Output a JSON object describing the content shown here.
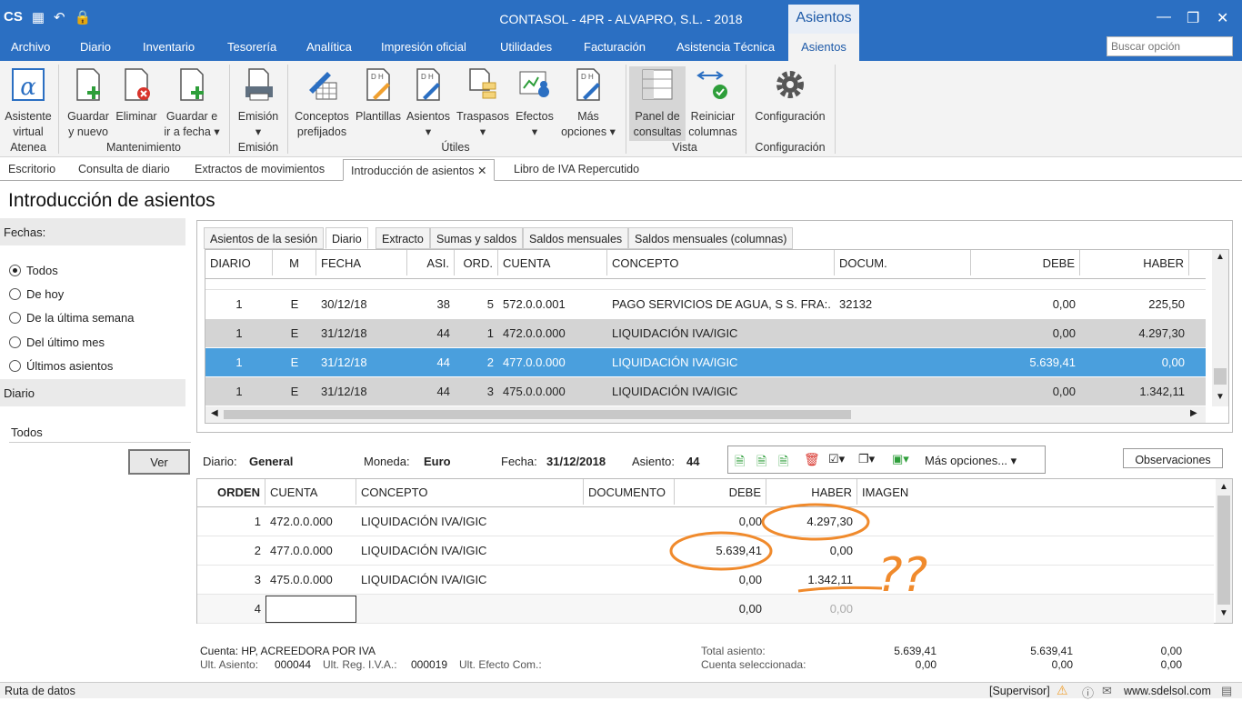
{
  "app": {
    "title": "CONTASOL - 4PR - ALVAPRO, S.L. - 2018",
    "context_tab": "Asientos",
    "logo_text": "CS"
  },
  "menu": {
    "items": [
      "Archivo",
      "Diario",
      "Inventario",
      "Tesorería",
      "Analítica",
      "Impresión oficial",
      "Utilidades",
      "Facturación",
      "Asistencia Técnica"
    ],
    "active": "Asientos",
    "search_placeholder": "Buscar opción"
  },
  "ribbon": {
    "buttons": [
      {
        "label1": "Asistente",
        "label2": "virtual"
      },
      {
        "label1": "Guardar",
        "label2": "y nuevo"
      },
      {
        "label1": "Eliminar",
        "label2": ""
      },
      {
        "label1": "Guardar e",
        "label2": "ir a fecha"
      },
      {
        "label1": "Emisión",
        "label2": ""
      },
      {
        "label1": "Conceptos",
        "label2": "prefijados"
      },
      {
        "label1": "Plantillas",
        "label2": ""
      },
      {
        "label1": "Asientos",
        "label2": ""
      },
      {
        "label1": "Traspasos",
        "label2": ""
      },
      {
        "label1": "Efectos",
        "label2": ""
      },
      {
        "label1": "Más",
        "label2": "opciones"
      },
      {
        "label1": "Panel de",
        "label2": "consultas"
      },
      {
        "label1": "Reiniciar",
        "label2": "columnas"
      },
      {
        "label1": "Configuración",
        "label2": ""
      }
    ],
    "groups": [
      "Atenea",
      "Mantenimiento",
      "Emisión",
      "Útiles",
      "Vista",
      "Configuración"
    ]
  },
  "doc_tabs": [
    "Escritorio",
    "Consulta de diario",
    "Extractos de movimientos",
    "Introducción de asientos",
    "Libro de IVA Repercutido"
  ],
  "page": {
    "title": "Introducción de asientos",
    "fechas_label": "Fechas:",
    "radios": [
      "Todos",
      "De hoy",
      "De la última semana",
      "Del último mes",
      "Últimos asientos"
    ],
    "diario_label": "Diario",
    "diario_value": "Todos",
    "ver_button": "Ver"
  },
  "upper": {
    "tabs": [
      "Asientos de la sesión",
      "Diario",
      "Extracto",
      "Sumas y saldos",
      "Saldos mensuales",
      "Saldos mensuales (columnas)"
    ],
    "columns": [
      "DIARIO",
      "M",
      "FECHA",
      "ASI.",
      "ORD.",
      "CUENTA",
      "CONCEPTO",
      "DOCUM.",
      "DEBE",
      "HABER"
    ],
    "rows": [
      [
        "1",
        "E",
        "30/12/18",
        "38",
        "5",
        "572.0.0.001",
        "PAGO SERVICIOS DE AGUA, S S. FRA:...",
        "32132",
        "0,00",
        "225,50"
      ],
      [
        "1",
        "E",
        "31/12/18",
        "44",
        "1",
        "472.0.0.000",
        "LIQUIDACIÓN IVA/IGIC",
        "",
        "0,00",
        "4.297,30"
      ],
      [
        "1",
        "E",
        "31/12/18",
        "44",
        "2",
        "477.0.0.000",
        "LIQUIDACIÓN IVA/IGIC",
        "",
        "5.639,41",
        "0,00"
      ],
      [
        "1",
        "E",
        "31/12/18",
        "44",
        "3",
        "475.0.0.000",
        "LIQUIDACIÓN IVA/IGIC",
        "",
        "0,00",
        "1.342,11"
      ]
    ]
  },
  "header_info": {
    "diario_lbl": "Diario:",
    "diario_val": "General",
    "moneda_lbl": "Moneda:",
    "moneda_val": "Euro",
    "fecha_lbl": "Fecha:",
    "fecha_val": "31/12/2018",
    "asiento_lbl": "Asiento:",
    "asiento_val": "44",
    "mas_opciones": "Más opciones...",
    "observaciones": "Observaciones"
  },
  "lower": {
    "columns": [
      "ORDEN",
      "CUENTA",
      "CONCEPTO",
      "DOCUMENTO",
      "DEBE",
      "HABER",
      "IMAGEN"
    ],
    "rows": [
      [
        "1",
        "472.0.0.000",
        "LIQUIDACIÓN IVA/IGIC",
        "",
        "0,00",
        "4.297,30"
      ],
      [
        "2",
        "477.0.0.000",
        "LIQUIDACIÓN IVA/IGIC",
        "",
        "5.639,41",
        "0,00"
      ],
      [
        "3",
        "475.0.0.000",
        "LIQUIDACIÓN IVA/IGIC",
        "",
        "0,00",
        "1.342,11"
      ],
      [
        "4",
        "",
        "",
        "",
        "0,00",
        "0,00"
      ]
    ]
  },
  "footer": {
    "cuenta": "Cuenta: HP, ACREEDORA POR IVA",
    "ult_asiento_lbl": "Ult. Asiento:",
    "ult_asiento_val": "000044",
    "ult_reg_lbl": "Ult. Reg. I.V.A.:",
    "ult_reg_val": "000019",
    "ult_efecto_lbl": "Ult. Efecto Com.:",
    "total_lbl": "Total asiento:",
    "cuenta_sel_lbl": "Cuenta seleccionada:",
    "total_vals": [
      "5.639,41",
      "5.639,41",
      "0,00"
    ],
    "sel_vals": [
      "0,00",
      "0,00",
      "0,00"
    ]
  },
  "annotation": "??",
  "status": {
    "left": "Ruta de datos",
    "user": "[Supervisor]",
    "site": "www.sdelsol.com"
  },
  "colors": {
    "accent": "#2b6fc2",
    "selected_row": "#4a9fdd",
    "grey_row": "#d4d4d4",
    "annotation": "#f08a2c"
  }
}
